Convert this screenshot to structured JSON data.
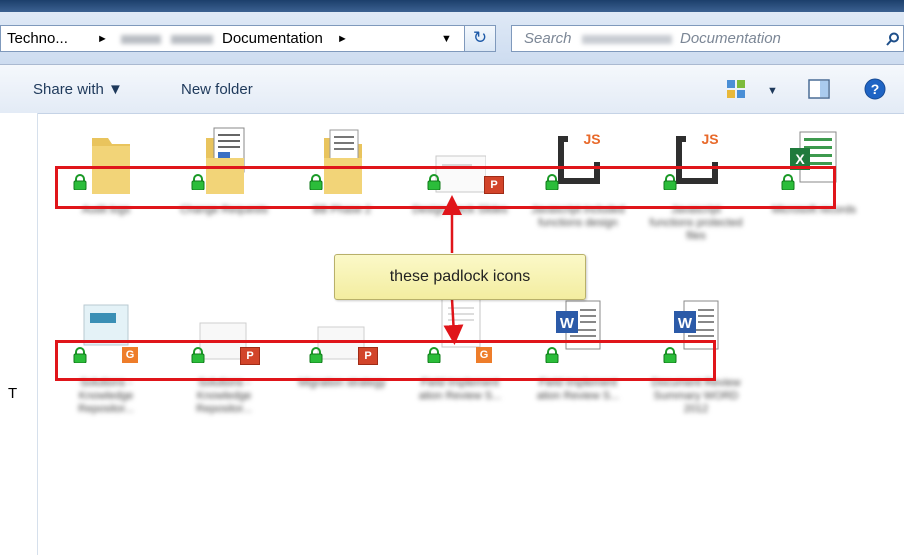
{
  "address": {
    "crumb1": "Techno...",
    "crumb3": "Documentation",
    "sep": "►",
    "dropdown": "▼",
    "refresh": "↻"
  },
  "search": {
    "placeholder": "Search",
    "suffix": "Documentation"
  },
  "toolbar": {
    "share_with": "Share with ▼",
    "new_folder": "New folder",
    "views": "▼",
    "help": "?"
  },
  "callout": {
    "text": "these padlock icons"
  },
  "left_letter": "T",
  "badges": {
    "ppt": "P",
    "gdoc": "G",
    "word": "W",
    "excel": "X",
    "js": "JS"
  },
  "files": [
    {
      "name": "Audit logs",
      "type": "folder"
    },
    {
      "name": "Change Requests",
      "type": "document-folder"
    },
    {
      "name": "BB Phase 2",
      "type": "folder-docs"
    },
    {
      "name": "Design Deck Slides",
      "type": "ppt"
    },
    {
      "name": "Javascript included functions design",
      "type": "js"
    },
    {
      "name": "Javascript functions protected files",
      "type": "js"
    },
    {
      "name": "Microsoft records",
      "type": "excel"
    },
    {
      "name": "Solutions - Knowledge Repositor...",
      "type": "gdoc-image"
    },
    {
      "name": "Solutions - Knowledge Repositor...",
      "type": "ppt"
    },
    {
      "name": "Migration strategy",
      "type": "ppt"
    },
    {
      "name": "Field Implement ation Review S...",
      "type": "gdoc"
    },
    {
      "name": "Field Implement ation Review S...",
      "type": "word"
    },
    {
      "name": "Document Review Summary WORD 2012",
      "type": "word"
    }
  ]
}
